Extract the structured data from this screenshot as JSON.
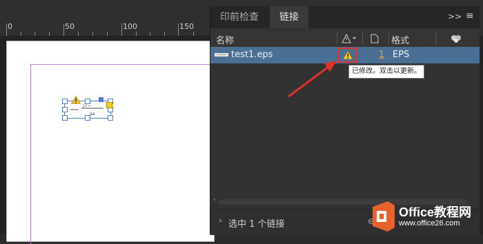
{
  "ruler": {
    "labels": [
      "0",
      "50",
      "100",
      "150"
    ]
  },
  "panel": {
    "tabs": [
      "印前检查",
      "链接"
    ],
    "header": {
      "name": "名称",
      "format": "格式"
    },
    "rows": [
      {
        "name": "test1.eps",
        "page": "1",
        "format": "EPS"
      }
    ],
    "status": "选中 1 个链接"
  },
  "tooltip": "已修改。双击以更新。",
  "watermark": {
    "title": "Office教程网",
    "url": "www.office26.com"
  },
  "colors": {
    "accent": "#4a6f94",
    "warning": "#f2c230",
    "arrow": "#e0322b",
    "brand": "#e8632c"
  }
}
